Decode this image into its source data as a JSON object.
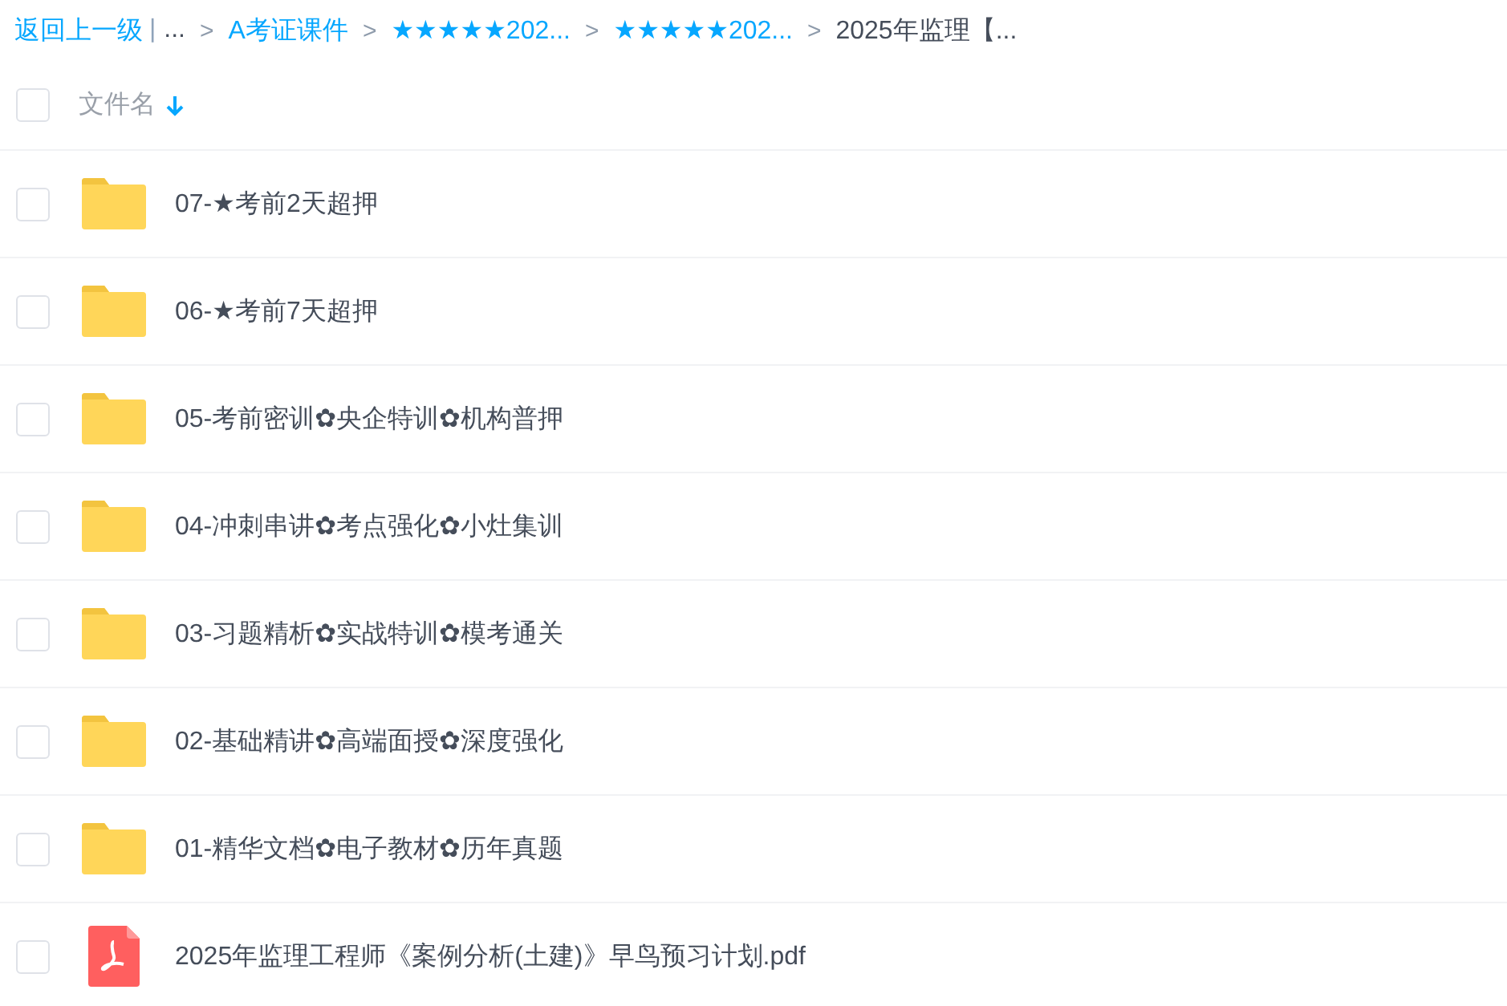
{
  "breadcrumb": {
    "back": "返回上一级",
    "divider": "|",
    "separator": ">",
    "items": [
      {
        "label": "...",
        "kind": "plain"
      },
      {
        "label": "A考证课件",
        "kind": "link"
      },
      {
        "label": "★★★★★202...",
        "kind": "link"
      },
      {
        "label": "★★★★★202...",
        "kind": "link"
      },
      {
        "label": "2025年监理【...",
        "kind": "current"
      }
    ]
  },
  "header": {
    "checked": false,
    "column": "文件名",
    "sort_descending": true
  },
  "files": [
    {
      "kind": "folder",
      "name": "07-★考前2天超押",
      "checked": false
    },
    {
      "kind": "folder",
      "name": "06-★考前7天超押",
      "checked": false
    },
    {
      "kind": "folder",
      "name": "05-考前密训✿央企特训✿机构普押",
      "checked": false
    },
    {
      "kind": "folder",
      "name": "04-冲刺串讲✿考点强化✿小灶集训",
      "checked": false
    },
    {
      "kind": "folder",
      "name": "03-习题精析✿实战特训✿模考通关",
      "checked": false
    },
    {
      "kind": "folder",
      "name": "02-基础精讲✿高端面授✿深度强化",
      "checked": false
    },
    {
      "kind": "folder",
      "name": "01-精华文档✿电子教材✿历年真题",
      "checked": false
    },
    {
      "kind": "pdf",
      "name": "2025年监理工程师《案例分析(土建)》早鸟预习计划.pdf",
      "checked": false
    }
  ]
}
